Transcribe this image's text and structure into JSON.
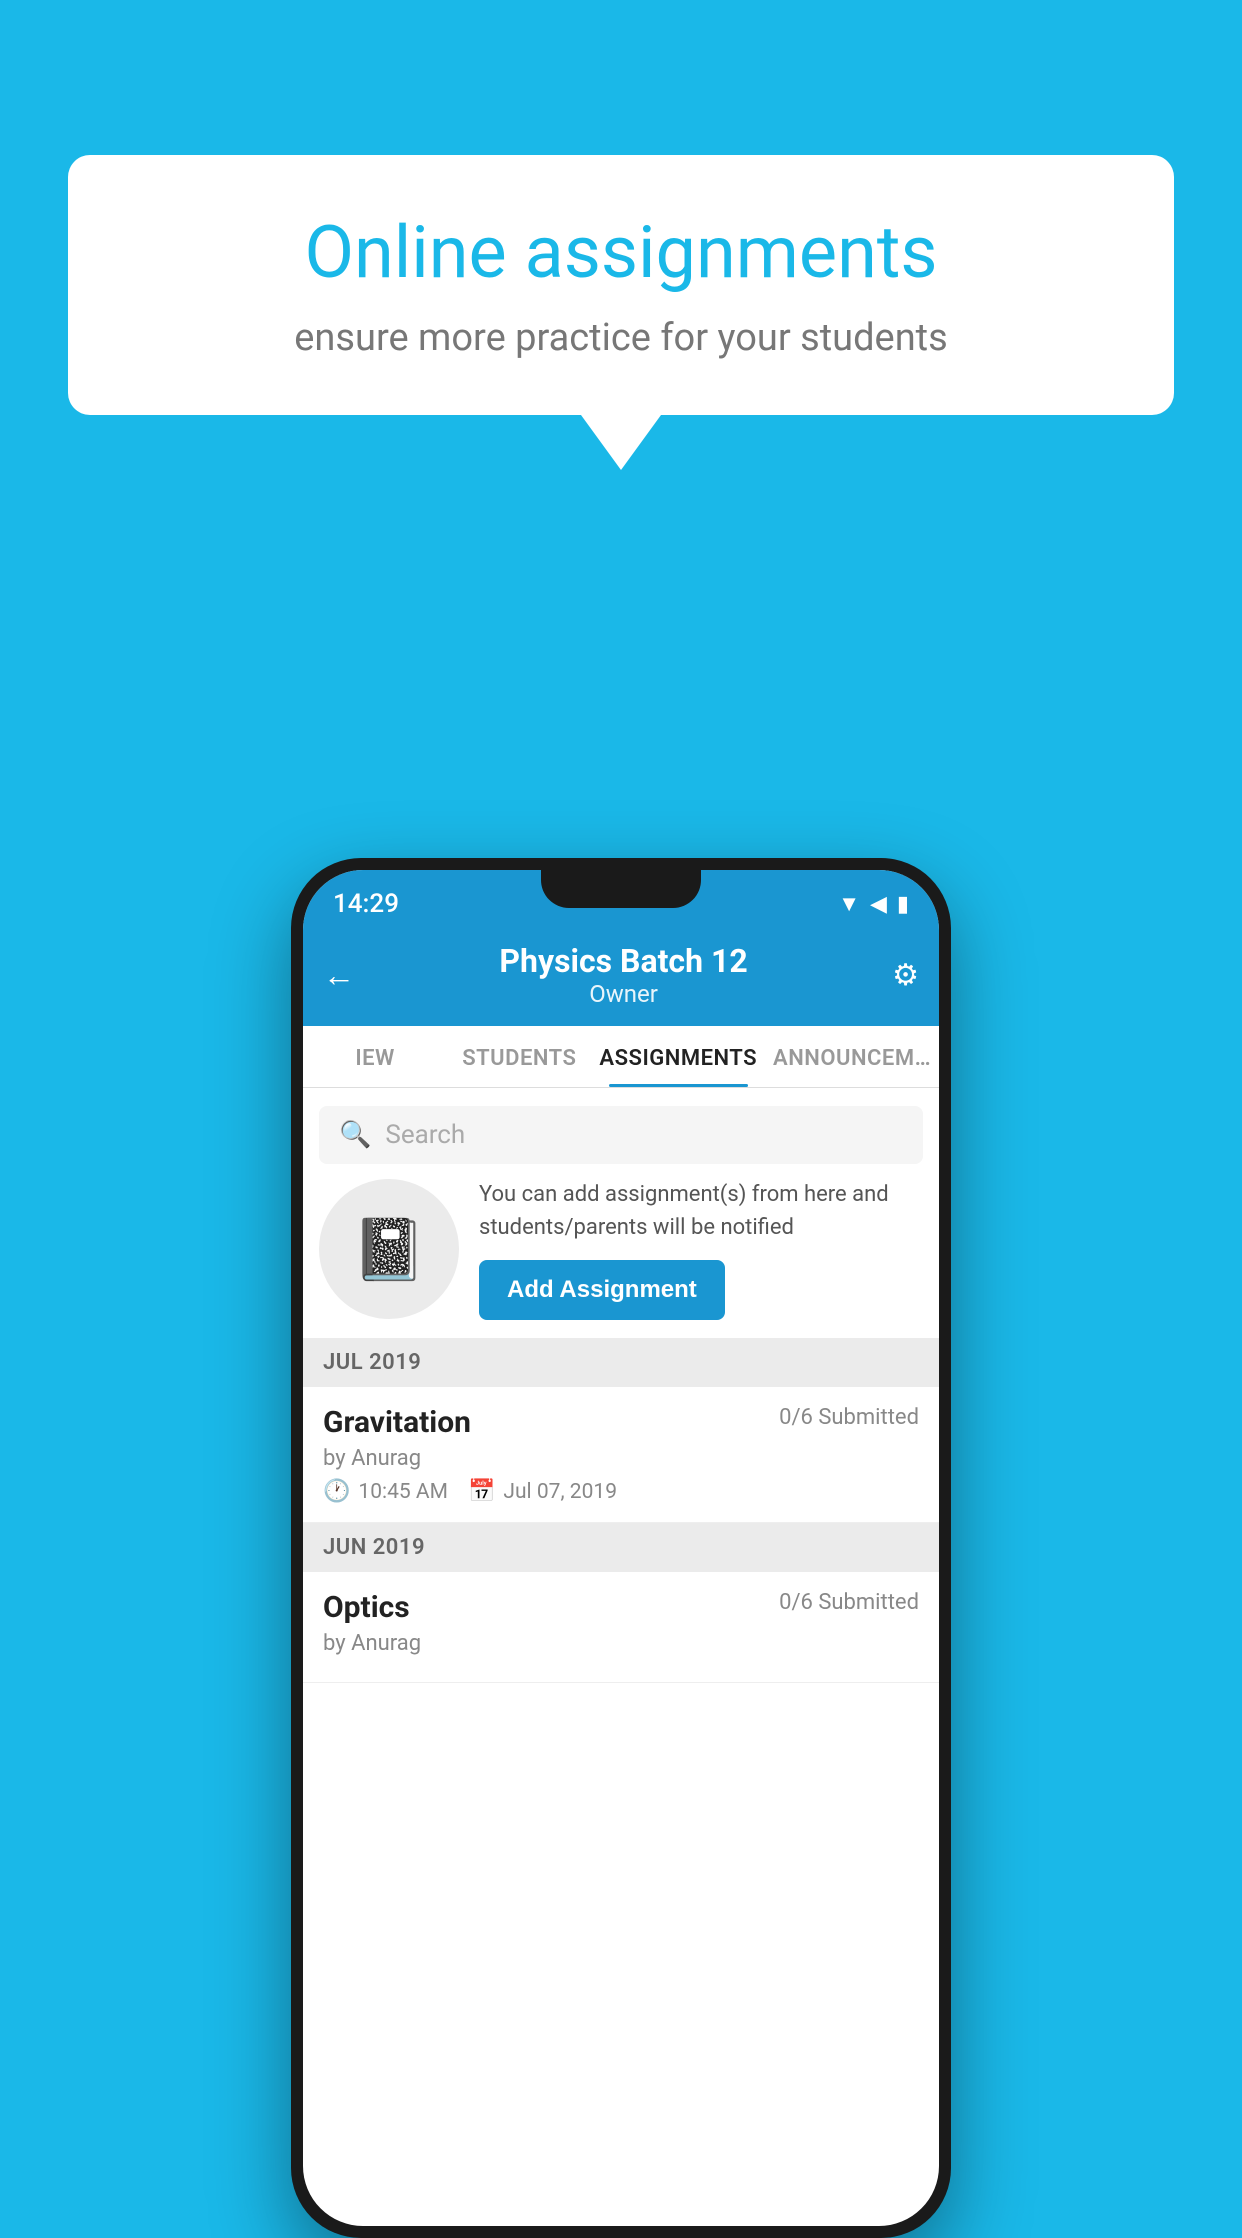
{
  "background": {
    "color": "#1ab8e8"
  },
  "speech_bubble": {
    "title": "Online assignments",
    "subtitle": "ensure more practice for your students"
  },
  "status_bar": {
    "time": "14:29",
    "icons": "▼ ◀ ▮"
  },
  "header": {
    "title": "Physics Batch 12",
    "subtitle": "Owner",
    "back_label": "←",
    "settings_label": "⚙"
  },
  "tabs": [
    {
      "label": "IEW",
      "active": false
    },
    {
      "label": "STUDENTS",
      "active": false
    },
    {
      "label": "ASSIGNMENTS",
      "active": true
    },
    {
      "label": "ANNOUNCEM…",
      "active": false
    }
  ],
  "search": {
    "placeholder": "Search"
  },
  "promo": {
    "text": "You can add assignment(s) from here and students/parents will be notified",
    "button_label": "Add Assignment"
  },
  "sections": [
    {
      "header": "JUL 2019",
      "assignments": [
        {
          "title": "Gravitation",
          "submitted": "0/6 Submitted",
          "author": "by Anurag",
          "time": "10:45 AM",
          "date": "Jul 07, 2019"
        }
      ]
    },
    {
      "header": "JUN 2019",
      "assignments": [
        {
          "title": "Optics",
          "submitted": "0/6 Submitted",
          "author": "by Anurag",
          "time": "",
          "date": ""
        }
      ]
    }
  ]
}
